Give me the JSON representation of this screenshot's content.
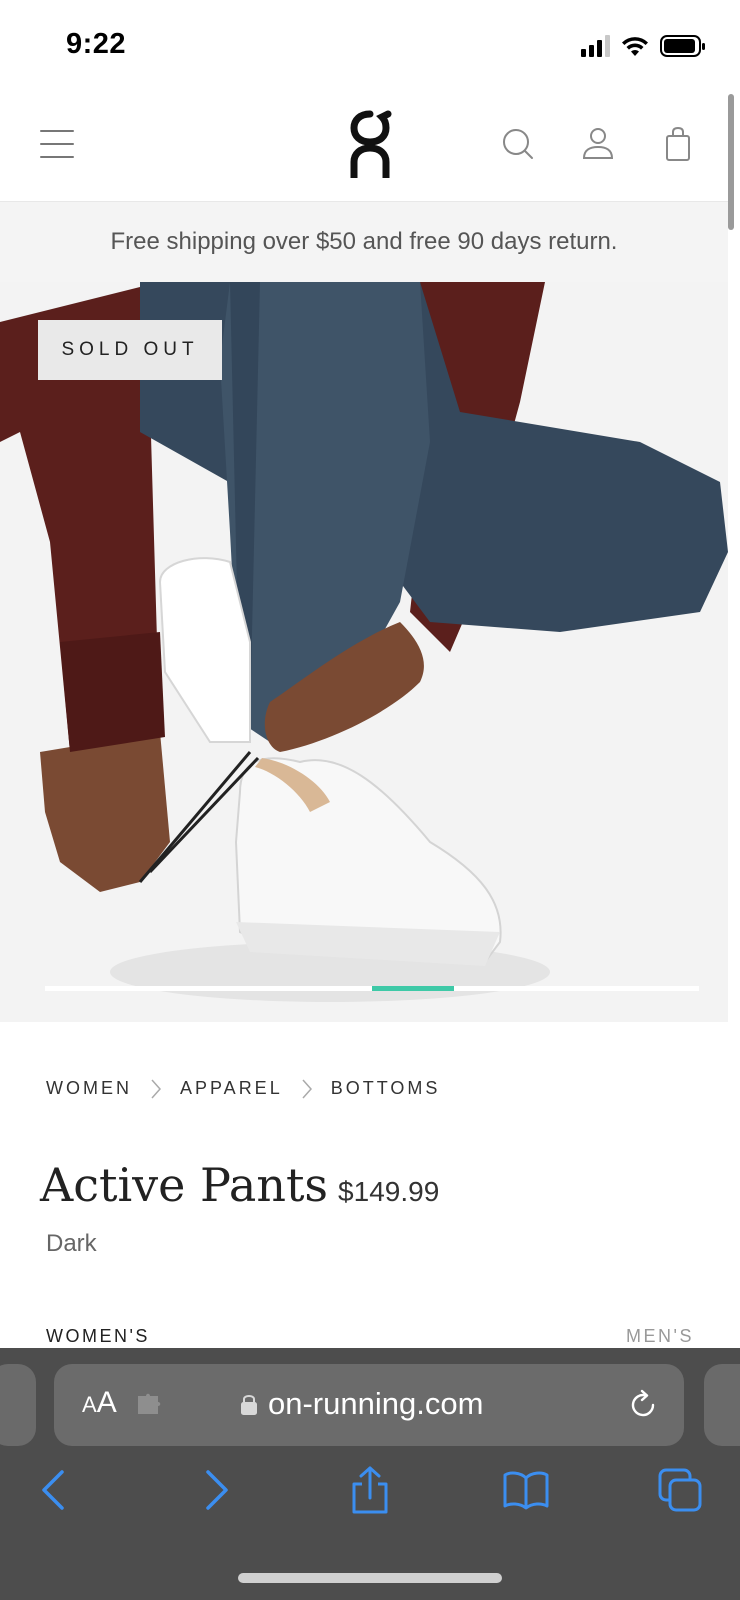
{
  "status_bar": {
    "time": "9:22"
  },
  "header": {
    "logo_alt": "On",
    "icons": [
      "menu-icon",
      "search-icon",
      "account-icon",
      "bag-icon"
    ]
  },
  "announcement": {
    "text": "Free shipping over $50 and free 90 days return."
  },
  "hero": {
    "badge": "SOLD OUT",
    "carousel": {
      "active_index": 4,
      "total": 8
    }
  },
  "breadcrumb": [
    "WOMEN",
    "APPAREL",
    "BOTTOMS"
  ],
  "product": {
    "title": "Active Pants",
    "price": "$149.99",
    "color": "Dark"
  },
  "size_tabs": {
    "left": "WOMEN'S",
    "right": "MEN'S"
  },
  "browser": {
    "text_size_small": "A",
    "text_size_big": "A",
    "url": "on-running.com",
    "toolbar": [
      "back-icon",
      "forward-icon",
      "share-icon",
      "bookmarks-icon",
      "tabs-icon"
    ]
  },
  "colors": {
    "accent": "#3ec9a7",
    "safari_blue": "#3b8ef0",
    "browser_bg": "#4d4d4d"
  }
}
